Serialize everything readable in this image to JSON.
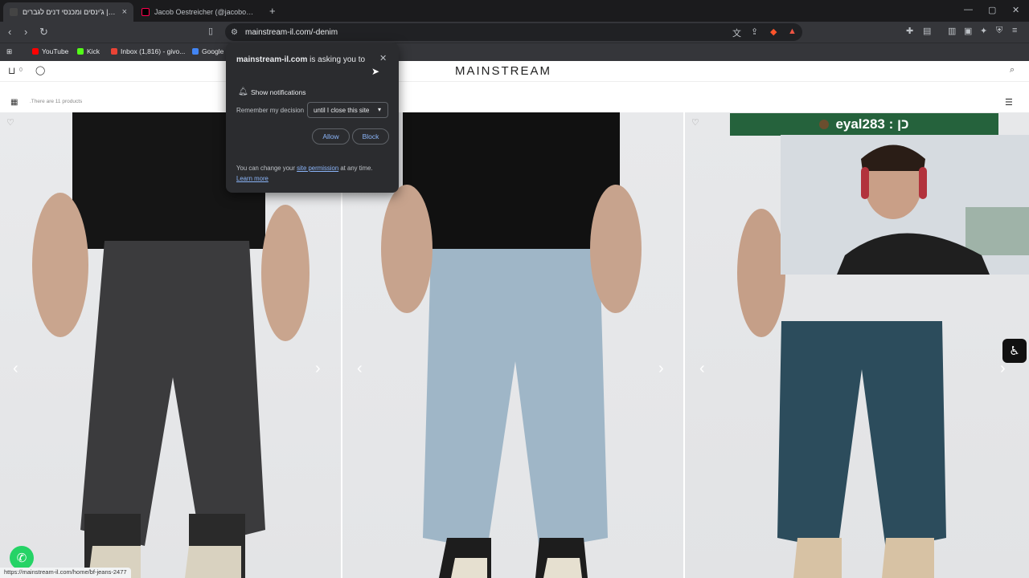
{
  "browser": {
    "tabs": [
      {
        "title": "ג'ינסים ומכנסי דנים לגברים | eam",
        "active": true
      },
      {
        "title": "Jacob Oestreicher (@jacoboestreiche...",
        "active": false
      }
    ],
    "url": "mainstream-il.com/-denim",
    "bookmarks": [
      "YouTube",
      "Kick",
      "Inbox (1,816) - givo...",
      "Google"
    ]
  },
  "site": {
    "logo": "MAINSTREAM",
    "cart_count": "0",
    "product_count": ".There are 11 products"
  },
  "notification": {
    "site": "mainstream-il.com",
    "asking": "is asking you to",
    "permission": "Show notifications",
    "remember_label": "Remember my decision",
    "remember_value": "until I close this site",
    "allow": "Allow",
    "block": "Block",
    "footer_prefix": "You can change your",
    "footer_link": "site permission",
    "footer_suffix": "at any time.",
    "learn_more": "Learn more"
  },
  "stream": {
    "overlay_text": "eyal283 : כן"
  },
  "status_bar": "https://mainstream-il.com/home/bf-jeans-2477",
  "colors": {
    "stream_overlay": "#25623c",
    "accent_link": "#8ab4f8"
  }
}
